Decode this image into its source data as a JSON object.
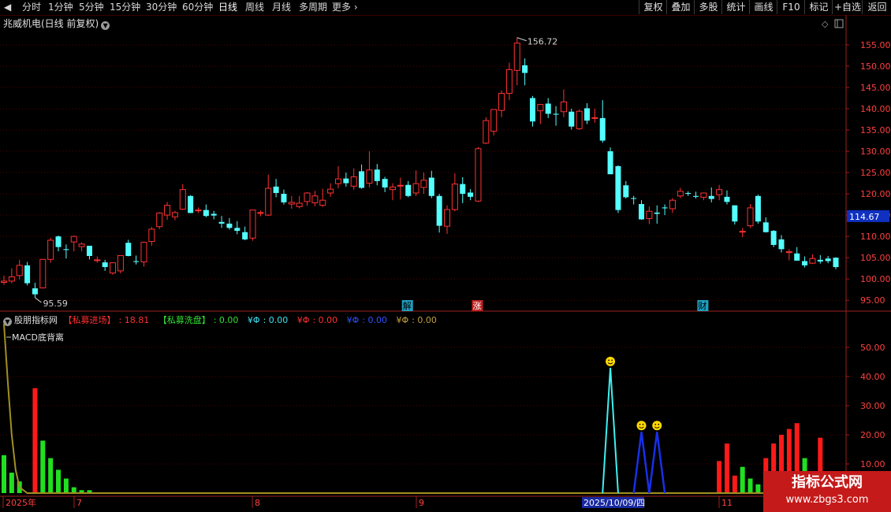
{
  "toolbar": {
    "timeframes": [
      "分时",
      "1分钟",
      "5分钟",
      "15分钟",
      "30分钟",
      "60分钟",
      "日线",
      "周线",
      "月线",
      "多周期",
      "更多"
    ],
    "active_timeframe": "日线",
    "buttons": [
      "复权",
      "叠加",
      "多股",
      "统计",
      "画线",
      "F10",
      "标记",
      "+自选",
      "返回"
    ]
  },
  "stock": {
    "title": "兆威机电(日线 前复权)"
  },
  "price_axis": {
    "ticks": [
      "155.00",
      "150.00",
      "145.00",
      "140.00",
      "135.00",
      "130.00",
      "125.00",
      "120.00",
      "115.00",
      "110.00",
      "105.00",
      "100.00",
      "95.00"
    ],
    "current_price": "114.67"
  },
  "annotations": {
    "high_label": "156.72",
    "low_label": "95.59",
    "markers": [
      "解",
      "涨",
      "财"
    ]
  },
  "indicator": {
    "name": "股朋指标网",
    "items": [
      {
        "label": "【私募进场】",
        "value": ": 18.81",
        "color": "#ff3030"
      },
      {
        "label": "【私募洗盘】",
        "value": ": 0.00",
        "color": "#30e030"
      },
      {
        "label": "¥Φ",
        "value": ": 0.00",
        "color": "#40e0f0"
      },
      {
        "label": "¥Φ",
        "value": ": 0.00",
        "color": "#ff3030"
      },
      {
        "label": "¥Φ",
        "value": ": 0.00",
        "color": "#3050ff"
      },
      {
        "label": "¥Φ",
        "value": ": 0.00",
        "color": "#c0a040"
      }
    ],
    "macd_label": "MACD底背离",
    "axis_ticks": [
      "50.00",
      "40.00",
      "30.00",
      "20.00",
      "10.00"
    ]
  },
  "date_axis": {
    "labels": [
      "2025年",
      "7",
      "8",
      "9",
      "11"
    ],
    "highlight": "2025/10/09/四"
  },
  "watermark": {
    "line1": "指标公式网",
    "line2": "www.zbgs3.com"
  },
  "colors": {
    "up": "#ff3232",
    "down": "#54ffff",
    "grid": "#5a0000",
    "axis": "#a02020"
  },
  "chart_data": {
    "type": "candlestick",
    "candles": [
      [
        99.2,
        100.8,
        98.6,
        99.5
      ],
      [
        99.5,
        102.5,
        99.0,
        100.5
      ],
      [
        100.8,
        104.5,
        99.9,
        103.2
      ],
      [
        103.2,
        104.0,
        98.5,
        99.0
      ],
      [
        97.8,
        99.1,
        95.6,
        96.4
      ],
      [
        97.9,
        104.6,
        97.8,
        104.6
      ],
      [
        104.6,
        109.7,
        103.8,
        109.1
      ],
      [
        110.0,
        110.2,
        106.5,
        107.5
      ],
      [
        107.0,
        108.1,
        104.8,
        106.8
      ],
      [
        108.7,
        110.2,
        106.5,
        110.0
      ],
      [
        107.6,
        108.6,
        106.5,
        108.2
      ],
      [
        107.8,
        107.8,
        104.6,
        105.4
      ],
      [
        104.3,
        105.3,
        103.8,
        104.5
      ],
      [
        103.9,
        104.5,
        101.9,
        102.8
      ],
      [
        101.4,
        103.8,
        101.0,
        103.8
      ],
      [
        101.9,
        105.5,
        101.3,
        105.5
      ],
      [
        108.5,
        109.2,
        105.3,
        105.4
      ],
      [
        104.2,
        105.5,
        103.4,
        104.0
      ],
      [
        104.0,
        108.8,
        102.9,
        108.6
      ],
      [
        108.8,
        112.2,
        107.8,
        111.7
      ],
      [
        112.3,
        115.7,
        111.7,
        115.5
      ],
      [
        115.0,
        118.1,
        113.9,
        117.3
      ],
      [
        114.6,
        116.0,
        113.8,
        115.6
      ],
      [
        116.4,
        122.3,
        116.2,
        121.0
      ],
      [
        119.5,
        119.7,
        115.5,
        115.5
      ],
      [
        116.1,
        116.8,
        115.5,
        116.2
      ],
      [
        116.2,
        117.5,
        114.5,
        114.8
      ],
      [
        115.3,
        116.0,
        114.0,
        114.9
      ],
      [
        113.4,
        114.8,
        112.0,
        113.0
      ],
      [
        113.0,
        114.3,
        111.6,
        112.0
      ],
      [
        112.0,
        113.6,
        110.5,
        111.3
      ],
      [
        111.0,
        112.3,
        109.1,
        109.3
      ],
      [
        109.6,
        116.3,
        109.0,
        116.2
      ],
      [
        115.5,
        116.1,
        114.7,
        115.6
      ],
      [
        115.0,
        124.5,
        114.8,
        121.3
      ],
      [
        121.7,
        123.5,
        119.2,
        120.2
      ],
      [
        120.0,
        121.0,
        117.5,
        118.0
      ],
      [
        117.6,
        119.5,
        116.5,
        118.0
      ],
      [
        117.0,
        119.5,
        116.6,
        117.8
      ],
      [
        118.2,
        120.4,
        117.2,
        120.2
      ],
      [
        117.9,
        120.7,
        117.1,
        119.5
      ],
      [
        117.3,
        121.2,
        116.9,
        118.5
      ],
      [
        120.2,
        122.5,
        119.3,
        121.1
      ],
      [
        122.4,
        126.5,
        121.3,
        123.5
      ],
      [
        123.6,
        125.0,
        121.7,
        122.5
      ],
      [
        121.8,
        126.0,
        121.0,
        124.0
      ],
      [
        125.3,
        126.9,
        121.2,
        121.4
      ],
      [
        122.5,
        130.0,
        121.5,
        125.6
      ],
      [
        125.7,
        127.0,
        122.0,
        123.0
      ],
      [
        123.5,
        124.0,
        120.4,
        121.5
      ],
      [
        121.0,
        122.5,
        118.5,
        121.6
      ],
      [
        121.9,
        123.8,
        118.7,
        122.0
      ],
      [
        122.1,
        123.0,
        119.2,
        119.5
      ],
      [
        120.2,
        125.5,
        119.5,
        122.4
      ],
      [
        121.5,
        125.0,
        120.0,
        123.2
      ],
      [
        123.8,
        125.4,
        119.0,
        119.5
      ],
      [
        119.5,
        120.0,
        110.9,
        112.5
      ],
      [
        112.4,
        117.3,
        110.6,
        116.3
      ],
      [
        116.3,
        124.8,
        115.9,
        122.3
      ],
      [
        122.3,
        123.9,
        117.8,
        120.0
      ],
      [
        120.3,
        121.1,
        118.5,
        119.3
      ],
      [
        118.3,
        131.0,
        118.1,
        130.6
      ],
      [
        131.9,
        138.0,
        131.7,
        137.2
      ],
      [
        134.7,
        138.5,
        133.7,
        139.8
      ],
      [
        139.6,
        144.3,
        138.0,
        143.6
      ],
      [
        143.6,
        150.8,
        142.0,
        149.2
      ],
      [
        149.0,
        156.7,
        145.5,
        155.4
      ],
      [
        150.2,
        151.8,
        145.5,
        148.4
      ],
      [
        142.5,
        143.0,
        135.8,
        137.0
      ],
      [
        139.5,
        141.0,
        136.4,
        141.0
      ],
      [
        141.2,
        142.5,
        137.8,
        138.8
      ],
      [
        138.8,
        140.6,
        136.0,
        138.6
      ],
      [
        139.3,
        144.5,
        138.0,
        141.6
      ],
      [
        139.3,
        140.0,
        135.1,
        135.8
      ],
      [
        135.3,
        139.8,
        135.0,
        139.4
      ],
      [
        140.1,
        141.3,
        136.4,
        137.2
      ],
      [
        137.9,
        140.0,
        136.7,
        137.9
      ],
      [
        137.8,
        142.0,
        132.0,
        132.5
      ],
      [
        130.0,
        130.9,
        126.9,
        124.6
      ],
      [
        126.5,
        126.7,
        115.5,
        116.2
      ],
      [
        122.0,
        123.0,
        118.9,
        119.2
      ],
      [
        119.0,
        119.5,
        117.5,
        118.9
      ],
      [
        117.6,
        118.5,
        113.9,
        114.0
      ],
      [
        114.2,
        117.0,
        112.9,
        115.9
      ],
      [
        115.6,
        117.3,
        113.0,
        115.3
      ],
      [
        116.8,
        117.5,
        115.0,
        116.6
      ],
      [
        116.5,
        119.0,
        115.5,
        118.5
      ],
      [
        119.5,
        121.4,
        119.0,
        120.6
      ],
      [
        120.2,
        120.6,
        119.5,
        120.0
      ],
      [
        119.5,
        120.5,
        118.9,
        119.3
      ],
      [
        119.2,
        120.3,
        118.5,
        120.2
      ],
      [
        119.5,
        121.5,
        118.0,
        118.8
      ],
      [
        119.8,
        122.1,
        118.5,
        121.0
      ],
      [
        119.3,
        120.8,
        117.5,
        118.1
      ],
      [
        117.3,
        117.3,
        112.8,
        113.5
      ],
      [
        111.0,
        112.0,
        109.8,
        111.2
      ],
      [
        112.5,
        117.6,
        112.0,
        116.7
      ],
      [
        119.5,
        119.8,
        113.0,
        113.5
      ],
      [
        113.3,
        114.5,
        110.9,
        111.0
      ],
      [
        111.3,
        111.5,
        107.5,
        108.0
      ],
      [
        109.3,
        110.3,
        106.2,
        107.0
      ],
      [
        106.2,
        107.0,
        104.4,
        106.4
      ],
      [
        106.0,
        107.5,
        105.1,
        104.3
      ],
      [
        104.2,
        105.3,
        102.7,
        103.2
      ],
      [
        103.7,
        105.8,
        103.5,
        104.8
      ],
      [
        104.5,
        105.6,
        103.6,
        104.1
      ],
      [
        104.8,
        105.4,
        103.7,
        104.2
      ],
      [
        105.0,
        105.1,
        102.3,
        102.8
      ]
    ],
    "price_range": [
      93.0,
      158.5
    ],
    "indicator_bars": {
      "red": [
        [
          4,
          36
        ],
        [
          92,
          11
        ],
        [
          93,
          17
        ],
        [
          94,
          6
        ],
        [
          98,
          12
        ],
        [
          99,
          17
        ],
        [
          100,
          20
        ],
        [
          101,
          22
        ],
        [
          102,
          24
        ],
        [
          105,
          19
        ]
      ],
      "green": [
        [
          0,
          13
        ],
        [
          1,
          7
        ],
        [
          2,
          4
        ],
        [
          5,
          18
        ],
        [
          6,
          12
        ],
        [
          7,
          8
        ],
        [
          8,
          5
        ],
        [
          9,
          2
        ],
        [
          10,
          1
        ],
        [
          11,
          1
        ],
        [
          95,
          9
        ],
        [
          96,
          5
        ],
        [
          97,
          3
        ],
        [
          103,
          12
        ]
      ]
    },
    "cyan_peak": [
      [
        77,
        0
      ],
      [
        78,
        43
      ],
      [
        79,
        0
      ]
    ],
    "blue_peaks": [
      [
        81,
        0
      ],
      [
        82,
        21
      ],
      [
        83,
        0
      ],
      [
        84,
        21
      ],
      [
        85,
        0
      ]
    ],
    "olive_curve": [
      [
        0,
        58
      ],
      [
        0.5,
        38
      ],
      [
        1,
        20
      ],
      [
        1.5,
        8
      ],
      [
        2,
        2
      ],
      [
        3,
        0
      ],
      [
        105,
        0
      ]
    ],
    "indicator_range": [
      0,
      60
    ]
  }
}
